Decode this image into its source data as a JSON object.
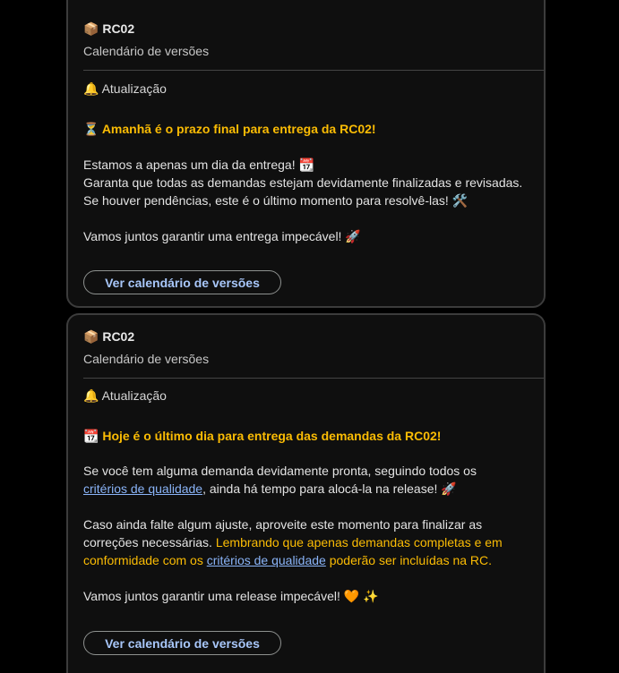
{
  "cards": [
    {
      "header": {
        "icon": "📦",
        "title": "RC02",
        "subtitle": "Calendário de versões"
      },
      "section": {
        "icon": "🔔",
        "label": "Atualização"
      },
      "headline": {
        "icon": "⏳",
        "text": "Amanhã é o prazo final para entrega da RC02!"
      },
      "lines": [
        "Estamos a apenas um dia da entrega! 📆",
        "Garanta que todas as demandas estejam devidamente finalizadas e revisadas.",
        "Se houver pendências, este é o último momento para resolvê-las! 🛠️",
        "Vamos juntos garantir uma entrega impecável! 🚀"
      ],
      "button_label": "Ver calendário de versões"
    },
    {
      "header": {
        "icon": "📦",
        "title": "RC02",
        "subtitle": "Calendário de versões"
      },
      "section": {
        "icon": "🔔",
        "label": "Atualização"
      },
      "headline": {
        "icon": "📆",
        "text": "Hoje é o último dia para entrega das demandas da RC02!"
      },
      "p1": {
        "a": "Se você tem alguma demanda devidamente pronta, seguindo todos os",
        "link": "critérios de qualidade",
        "b": ", ainda há tempo para alocá-la na release! 🚀"
      },
      "p2": {
        "a": "Caso ainda falte algum ajuste, aproveite este momento para finalizar as correções necessárias.",
        "yellow_a": "Lembrando que apenas demandas completas e em conformidade com os",
        "link": "critérios de qualidade",
        "yellow_b": "poderão ser incluídas na RC."
      },
      "p3": "Vamos juntos garantir uma release impecável! 🧡 ✨",
      "button_label": "Ver calendário de versões"
    }
  ]
}
